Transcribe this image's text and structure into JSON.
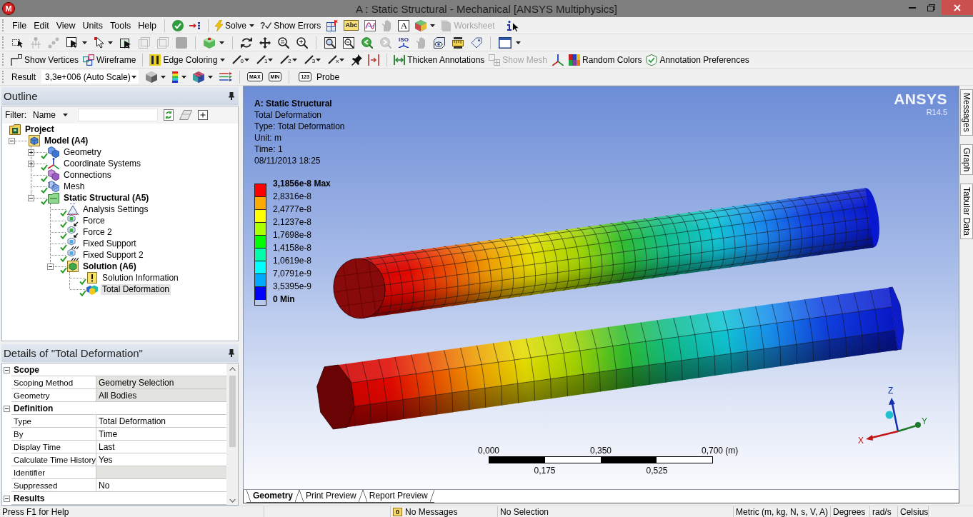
{
  "window": {
    "logo": "M",
    "title": "A : Static Structural - Mechanical [ANSYS Multiphysics]"
  },
  "menu": [
    "File",
    "Edit",
    "View",
    "Units",
    "Tools",
    "Help"
  ],
  "standard_toolbar": {
    "solve": "Solve",
    "show_errors": {
      "icon_text": "?",
      "label": "Show Errors"
    },
    "spelling_icon_text": "Abc",
    "text_icon_text": "A",
    "worksheet": {
      "label": "Worksheet",
      "disabled": true
    }
  },
  "graphics_toolbar": {
    "iso_icon_text": "ISO"
  },
  "display_toolbar": {
    "show_vertices": "Show Vertices",
    "wireframe": "Wireframe",
    "edge_coloring": "Edge Coloring",
    "edge_tools": [
      "0",
      "1",
      "2",
      "3",
      "x"
    ],
    "thicken_annotations": "Thicken Annotations",
    "show_mesh": {
      "label": "Show Mesh",
      "disabled": true
    },
    "random_colors": "Random Colors",
    "annotation_preferences": "Annotation Preferences"
  },
  "result_toolbar": {
    "label": "Result",
    "scale": "3,3e+006 (Auto Scale)",
    "max_icon_text": "MAX",
    "min_icon_text": "MIN",
    "probe_icon_text": "123",
    "probe": "Probe"
  },
  "outline": {
    "title": "Outline",
    "filter_label": "Filter:",
    "filter_by": "Name",
    "tree": [
      {
        "label": "Project",
        "kind": "project",
        "solved": false,
        "selected": false,
        "children": [
          {
            "label": "Model (A4)",
            "kind": "model",
            "solved": false,
            "expanded": true,
            "selected": false,
            "children": [
              {
                "label": "Geometry",
                "kind": "geometry",
                "solved": true,
                "expanded": false,
                "selected": false
              },
              {
                "label": "Coordinate Systems",
                "kind": "coordinate_systems",
                "solved": true,
                "expanded": false,
                "selected": false
              },
              {
                "label": "Connections",
                "kind": "connections",
                "solved": true,
                "selected": false
              },
              {
                "label": "Mesh",
                "kind": "mesh",
                "solved": true,
                "selected": false
              },
              {
                "label": "Static Structural (A5)",
                "kind": "analysis",
                "solved": true,
                "expanded": true,
                "selected": false,
                "children": [
                  {
                    "label": "Analysis Settings",
                    "kind": "analysis_settings",
                    "solved": true,
                    "selected": false
                  },
                  {
                    "label": "Force",
                    "kind": "force",
                    "solved": true,
                    "selected": false
                  },
                  {
                    "label": "Force 2",
                    "kind": "force",
                    "solved": true,
                    "selected": false
                  },
                  {
                    "label": "Fixed Support",
                    "kind": "support",
                    "solved": true,
                    "selected": false
                  },
                  {
                    "label": "Fixed Support 2",
                    "kind": "support",
                    "solved": true,
                    "selected": false
                  },
                  {
                    "label": "Solution (A6)",
                    "kind": "solution",
                    "solved": true,
                    "expanded": true,
                    "selected": false,
                    "children": [
                      {
                        "label": "Solution Information",
                        "kind": "solution_information",
                        "solved": true,
                        "selected": false
                      },
                      {
                        "label": "Total Deformation",
                        "kind": "result",
                        "solved": true,
                        "selected": true
                      }
                    ]
                  }
                ]
              }
            ]
          }
        ]
      }
    ]
  },
  "details": {
    "title": "Details of \"Total Deformation\"",
    "rows": [
      {
        "kind": "group",
        "name": "Scope",
        "expanded": true
      },
      {
        "kind": "property",
        "name": "Scoping Method",
        "value": "Geometry Selection",
        "shaded": true
      },
      {
        "kind": "property",
        "name": "Geometry",
        "value": "All Bodies",
        "shaded": true
      },
      {
        "kind": "group",
        "name": "Definition",
        "expanded": true
      },
      {
        "kind": "property",
        "name": "Type",
        "value": "Total Deformation",
        "shaded": false
      },
      {
        "kind": "property",
        "name": "By",
        "value": "Time",
        "shaded": false
      },
      {
        "kind": "property",
        "name": "Display Time",
        "value": "Last",
        "shaded": false
      },
      {
        "kind": "property",
        "name": "Calculate Time History",
        "value": "Yes",
        "shaded": false
      },
      {
        "kind": "property",
        "name": "Identifier",
        "shaded": true
      },
      {
        "kind": "property",
        "name": "Suppressed",
        "value": "No",
        "shaded": false
      },
      {
        "kind": "group",
        "name": "Results",
        "expanded": true
      }
    ]
  },
  "viewport": {
    "logo": {
      "name": "ANSYS",
      "version": "R14.5"
    },
    "info": {
      "title": "A: Static Structural",
      "lines": [
        "Total Deformation",
        "Type: Total Deformation",
        "Unit: m",
        "Time: 1",
        "08/11/2013 18:25"
      ]
    },
    "legend": {
      "labels": [
        "3,1856e-8 Max",
        "2,8316e-8",
        "2,4777e-8",
        "2,1237e-8",
        "1,7698e-8",
        "1,4158e-8",
        "1,0619e-8",
        "7,0791e-9",
        "3,5395e-9",
        "0 Min"
      ],
      "bands": [
        {
          "color": "#ff0000"
        },
        {
          "color": "#ffaa00"
        },
        {
          "color": "#ffff00"
        },
        {
          "color": "#aaff00"
        },
        {
          "color": "#00ff00"
        },
        {
          "color": "#00ffaa"
        },
        {
          "color": "#00ffff"
        },
        {
          "color": "#00aaff"
        },
        {
          "color": "#0000ff"
        }
      ]
    },
    "scale_bar": {
      "top_labels": [
        "0,000",
        "0,350",
        "0,700 (m)"
      ],
      "bottom_labels": [
        "0,175",
        "0,525"
      ]
    },
    "triad": {
      "axes": [
        "Z",
        "Y",
        "X"
      ]
    }
  },
  "side_tabs": [
    "Messages",
    "Graph",
    "Tabular Data"
  ],
  "view_tabs": [
    {
      "label": "Geometry",
      "selected": true
    },
    {
      "label": "Print Preview",
      "selected": false
    },
    {
      "label": "Report Preview",
      "selected": false
    }
  ],
  "status_bar": {
    "help": "Press F1 for Help",
    "message_count": "0",
    "messages": "No Messages",
    "selection": "No Selection",
    "units": "Metric (m, kg, N, s, V, A)",
    "angle": "Degrees",
    "angular_velocity": "rad/s",
    "temperature": "Celsius"
  }
}
